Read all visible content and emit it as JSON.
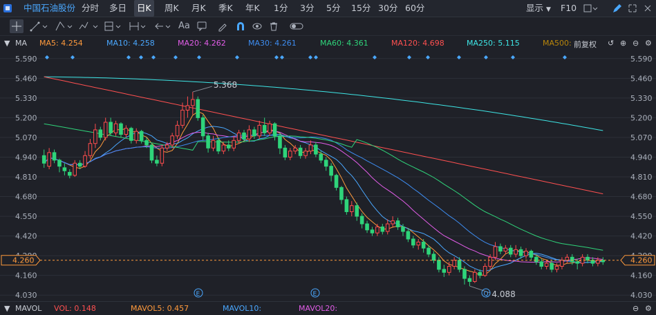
{
  "topbar": {
    "stock_name": "中国石油股份",
    "tabs": [
      "分时",
      "多日",
      "日K",
      "周K",
      "月K",
      "季K",
      "年K",
      "1分",
      "3分",
      "5分",
      "15分",
      "30分",
      "60分"
    ],
    "active_tab": "日K",
    "display_label": "显示",
    "f10_label": "F10"
  },
  "toolbar": {
    "text_tool_label": "Aa"
  },
  "ma_bar": {
    "indicator": "MA",
    "items": [
      {
        "label": "MA5: 4.254",
        "color": "#ff9a3c"
      },
      {
        "label": "MA10: 4.258",
        "color": "#4aa8ff"
      },
      {
        "label": "MA20: 4.262",
        "color": "#e25de8"
      },
      {
        "label": "MA30: 4.261",
        "color": "#3d8cf0"
      },
      {
        "label": "MA60: 4.361",
        "color": "#2fd47a"
      },
      {
        "label": "MA120: 4.698",
        "color": "#ff5050"
      },
      {
        "label": "MA250: 5.115",
        "color": "#3ee6e6"
      },
      {
        "label": "MA500:",
        "color": "#b8860b"
      }
    ],
    "adjust_label": "前复权"
  },
  "chart_data": {
    "type": "candlestick",
    "ylim": [
      3.99,
      5.63
    ],
    "y_ticks": [
      "5.590",
      "5.460",
      "5.330",
      "5.200",
      "5.070",
      "4.940",
      "4.810",
      "4.680",
      "4.550",
      "4.420",
      "4.290",
      "4.160",
      "4.030"
    ],
    "current_price": "4.260",
    "high_annotation": "5.368",
    "low_annotation": "4.088",
    "event_markers": [
      "E",
      "E",
      "Q"
    ],
    "candles": [
      [
        4.95,
        4.9,
        4.99,
        4.87
      ],
      [
        4.88,
        4.97,
        5.0,
        4.86
      ],
      [
        4.97,
        4.92,
        4.99,
        4.9
      ],
      [
        4.92,
        4.88,
        4.93,
        4.84
      ],
      [
        4.87,
        4.85,
        4.9,
        4.82
      ],
      [
        4.84,
        4.82,
        4.86,
        4.8
      ],
      [
        4.82,
        4.9,
        4.92,
        4.81
      ],
      [
        4.9,
        4.88,
        4.92,
        4.86
      ],
      [
        4.88,
        4.95,
        4.98,
        4.87
      ],
      [
        4.95,
        5.03,
        5.06,
        4.93
      ],
      [
        5.03,
        5.12,
        5.16,
        5.0
      ],
      [
        5.12,
        5.07,
        5.14,
        5.05
      ],
      [
        5.07,
        5.17,
        5.2,
        5.05
      ],
      [
        5.17,
        5.1,
        5.2,
        5.08
      ],
      [
        5.1,
        5.16,
        5.18,
        5.08
      ],
      [
        5.16,
        5.09,
        5.17,
        5.07
      ],
      [
        5.09,
        5.13,
        5.15,
        5.07
      ],
      [
        5.13,
        5.05,
        5.14,
        5.03
      ],
      [
        5.05,
        5.11,
        5.13,
        5.03
      ],
      [
        5.11,
        5.05,
        5.12,
        5.03
      ],
      [
        5.05,
        5.02,
        5.07,
        5.0
      ],
      [
        5.02,
        4.92,
        5.03,
        4.9
      ],
      [
        4.92,
        4.9,
        4.95,
        4.88
      ],
      [
        4.9,
        5.0,
        5.02,
        4.88
      ],
      [
        5.0,
        5.02,
        5.04,
        4.98
      ],
      [
        5.02,
        5.08,
        5.1,
        5.0
      ],
      [
        5.08,
        5.15,
        5.18,
        5.06
      ],
      [
        5.15,
        5.25,
        5.3,
        5.13
      ],
      [
        5.25,
        5.28,
        5.34,
        5.2
      ],
      [
        5.28,
        5.32,
        5.37,
        5.22
      ],
      [
        5.32,
        5.2,
        5.34,
        5.18
      ],
      [
        5.2,
        5.08,
        5.22,
        5.05
      ],
      [
        5.08,
        5.0,
        5.1,
        4.97
      ],
      [
        5.0,
        5.05,
        5.08,
        4.98
      ],
      [
        5.05,
        4.98,
        5.07,
        4.96
      ],
      [
        4.98,
        5.02,
        5.04,
        4.96
      ],
      [
        5.02,
        5.0,
        5.05,
        4.98
      ],
      [
        5.0,
        5.05,
        5.08,
        4.98
      ],
      [
        5.05,
        5.1,
        5.12,
        5.03
      ],
      [
        5.1,
        5.06,
        5.12,
        5.04
      ],
      [
        5.06,
        5.12,
        5.15,
        5.04
      ],
      [
        5.12,
        5.08,
        5.14,
        5.06
      ],
      [
        5.08,
        5.15,
        5.18,
        5.06
      ],
      [
        5.15,
        5.1,
        5.2,
        5.08
      ],
      [
        5.1,
        5.16,
        5.18,
        5.08
      ],
      [
        5.16,
        5.08,
        5.17,
        5.05
      ],
      [
        5.08,
        5.0,
        5.1,
        4.96
      ],
      [
        5.0,
        4.94,
        5.02,
        4.92
      ],
      [
        4.94,
        4.98,
        5.0,
        4.92
      ],
      [
        4.98,
        5.0,
        5.02,
        4.96
      ],
      [
        5.0,
        4.95,
        5.02,
        4.93
      ],
      [
        4.95,
        4.98,
        5.0,
        4.93
      ],
      [
        4.98,
        5.02,
        5.05,
        4.96
      ],
      [
        5.02,
        4.96,
        5.04,
        4.94
      ],
      [
        4.96,
        4.92,
        4.98,
        4.9
      ],
      [
        4.92,
        4.88,
        4.94,
        4.85
      ],
      [
        4.88,
        4.82,
        4.9,
        4.78
      ],
      [
        4.82,
        4.74,
        4.83,
        4.72
      ],
      [
        4.74,
        4.66,
        4.75,
        4.63
      ],
      [
        4.66,
        4.58,
        4.68,
        4.56
      ],
      [
        4.58,
        4.62,
        4.65,
        4.55
      ],
      [
        4.62,
        4.55,
        4.64,
        4.52
      ],
      [
        4.55,
        4.5,
        4.57,
        4.47
      ],
      [
        4.5,
        4.46,
        4.52,
        4.44
      ],
      [
        4.46,
        4.44,
        4.48,
        4.42
      ],
      [
        4.44,
        4.48,
        4.5,
        4.42
      ],
      [
        4.48,
        4.45,
        4.5,
        4.43
      ],
      [
        4.45,
        4.5,
        4.53,
        4.43
      ],
      [
        4.5,
        4.52,
        4.55,
        4.48
      ],
      [
        4.52,
        4.48,
        4.54,
        4.46
      ],
      [
        4.48,
        4.45,
        4.5,
        4.42
      ],
      [
        4.45,
        4.4,
        4.47,
        4.38
      ],
      [
        4.4,
        4.36,
        4.42,
        4.34
      ],
      [
        4.36,
        4.38,
        4.4,
        4.33
      ],
      [
        4.38,
        4.34,
        4.4,
        4.31
      ],
      [
        4.34,
        4.3,
        4.36,
        4.28
      ],
      [
        4.3,
        4.26,
        4.32,
        4.24
      ],
      [
        4.26,
        4.2,
        4.28,
        4.18
      ],
      [
        4.2,
        4.18,
        4.23,
        4.15
      ],
      [
        4.18,
        4.22,
        4.25,
        4.16
      ],
      [
        4.22,
        4.26,
        4.28,
        4.2
      ],
      [
        4.26,
        4.2,
        4.28,
        4.18
      ],
      [
        4.2,
        4.14,
        4.22,
        4.1
      ],
      [
        4.14,
        4.12,
        4.16,
        4.09
      ],
      [
        4.12,
        4.18,
        4.2,
        4.11
      ],
      [
        4.18,
        4.16,
        4.2,
        4.14
      ],
      [
        4.16,
        4.22,
        4.24,
        4.15
      ],
      [
        4.22,
        4.28,
        4.3,
        4.2
      ],
      [
        4.28,
        4.35,
        4.38,
        4.26
      ],
      [
        4.35,
        4.32,
        4.37,
        4.3
      ],
      [
        4.32,
        4.34,
        4.36,
        4.3
      ],
      [
        4.34,
        4.3,
        4.36,
        4.28
      ],
      [
        4.3,
        4.33,
        4.36,
        4.28
      ],
      [
        4.33,
        4.29,
        4.35,
        4.27
      ],
      [
        4.29,
        4.32,
        4.34,
        4.27
      ],
      [
        4.32,
        4.28,
        4.33,
        4.26
      ],
      [
        4.28,
        4.25,
        4.3,
        4.23
      ],
      [
        4.25,
        4.22,
        4.27,
        4.2
      ],
      [
        4.22,
        4.24,
        4.26,
        4.2
      ],
      [
        4.24,
        4.2,
        4.26,
        4.18
      ],
      [
        4.2,
        4.22,
        4.24,
        4.18
      ],
      [
        4.22,
        4.26,
        4.28,
        4.2
      ],
      [
        4.26,
        4.28,
        4.3,
        4.24
      ],
      [
        4.28,
        4.25,
        4.3,
        4.23
      ],
      [
        4.25,
        4.24,
        4.27,
        4.2
      ],
      [
        4.24,
        4.28,
        4.3,
        4.22
      ],
      [
        4.28,
        4.26,
        4.3,
        4.24
      ],
      [
        4.26,
        4.24,
        4.28,
        4.22
      ],
      [
        4.24,
        4.26,
        4.28,
        4.22
      ],
      [
        4.26,
        4.25,
        4.28,
        4.23
      ]
    ]
  },
  "footer": {
    "indicator": "MAVOL",
    "items": [
      {
        "label": "VOL: 0.148",
        "color": "#ff5050"
      },
      {
        "label": "MAVOL5: 0.457",
        "color": "#ff9a3c"
      },
      {
        "label": "MAVOL10:",
        "color": "#4aa8ff"
      },
      {
        "label": "MAVOL20:",
        "color": "#e25de8"
      }
    ]
  }
}
